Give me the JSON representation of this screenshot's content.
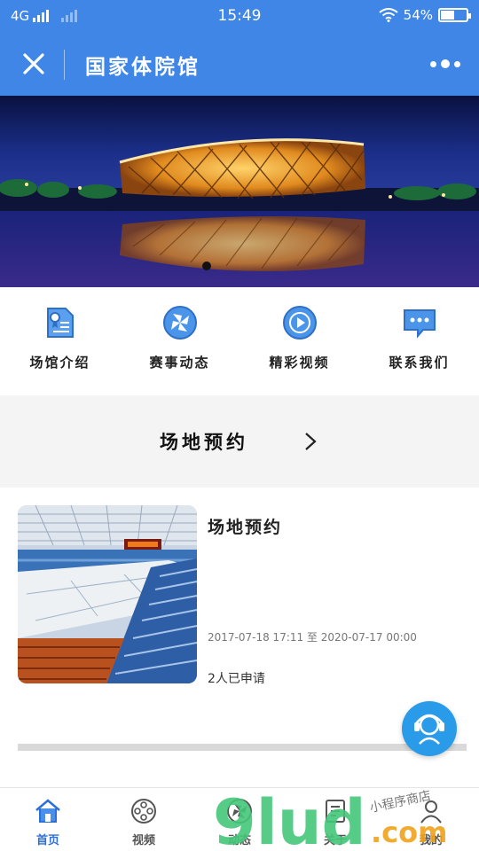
{
  "status_bar": {
    "network": "4G",
    "time": "15:49",
    "battery_percent": "54%",
    "battery_level": 0.54,
    "icons": [
      "signal-icon",
      "wifi-icon",
      "battery-icon"
    ]
  },
  "header": {
    "title": "国家体院馆",
    "close_icon": "close-icon",
    "more_icon": "more-dots-icon",
    "color": "#3f86e6"
  },
  "banner": {
    "image": "stadium-night-photo"
  },
  "quick_nav": [
    {
      "label": "场馆介绍",
      "icon": "document-icon"
    },
    {
      "label": "赛事动态",
      "icon": "pinwheel-icon"
    },
    {
      "label": "精彩视频",
      "icon": "play-icon"
    },
    {
      "label": "联系我们",
      "icon": "chat-icon"
    }
  ],
  "booking_section": {
    "title": "场地预约",
    "chevron_icon": "chevron-right-icon"
  },
  "booking_card": {
    "title": "场地预约",
    "dates": "2017-07-18 17:11 至 2020-07-17 00:00",
    "applicants": "2人已申请",
    "image": "indoor-arena-photo"
  },
  "tab_bar": [
    {
      "label": "首页",
      "icon": "home-icon",
      "active": true
    },
    {
      "label": "视频",
      "icon": "film-reel-icon",
      "active": false
    },
    {
      "label": "动态",
      "icon": "pinwheel-icon",
      "active": false
    },
    {
      "label": "关于",
      "icon": "info-icon",
      "active": false
    },
    {
      "label": "我的",
      "icon": "user-icon",
      "active": false
    }
  ],
  "watermark": {
    "main": "9lud",
    "suffix": ".com",
    "tagline": "小程序商店"
  },
  "colors": {
    "accent": "#3f86e6",
    "active_tab": "#2d6fd6",
    "service_button": "#2a9be8"
  }
}
